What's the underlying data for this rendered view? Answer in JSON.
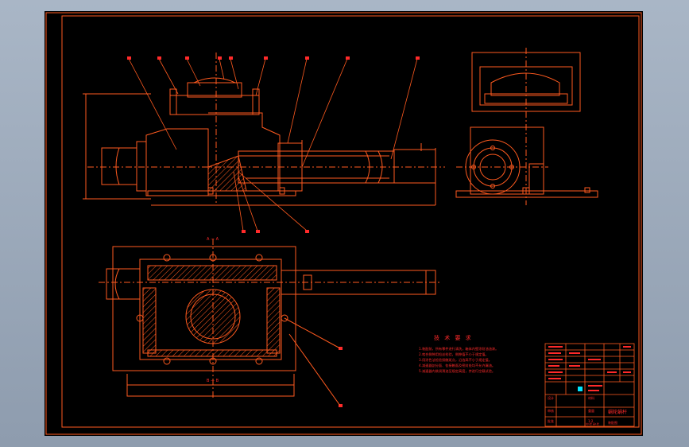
{
  "drawing": {
    "background_color": "#000000",
    "viewport_color": "#a9b6c6",
    "line_color": "#ff5a1f",
    "text_color": "#ff2a2a",
    "highlight_color": "#00e5ff",
    "section_label_top": "A — A",
    "section_label_bottom": "B — B"
  },
  "technical_requirements": {
    "title": "技 术 要 求",
    "items": [
      "1.装配前，所有零件进行清洗，箱体内壁涂耐油油漆。",
      "2.啮合侧隙用铅丝检验，侧隙值不小于规定值。",
      "3.用涂色法检验接触斑点，沿齿高不小于规定值。",
      "4.减速器剖分面、各接触面及密封处均不允许漏油。",
      "5.减速器内装润滑油至规定高度，并进行空载试验。"
    ]
  },
  "title_block": {
    "drawing_name": "蜗轮蜗杆",
    "scale": "1:2",
    "sheet": "共1张 第1张",
    "designer_label": "设计",
    "checker_label": "审核",
    "approver_label": "批准",
    "material_label": "材料",
    "weight_label": "重量",
    "code": "装配图"
  }
}
